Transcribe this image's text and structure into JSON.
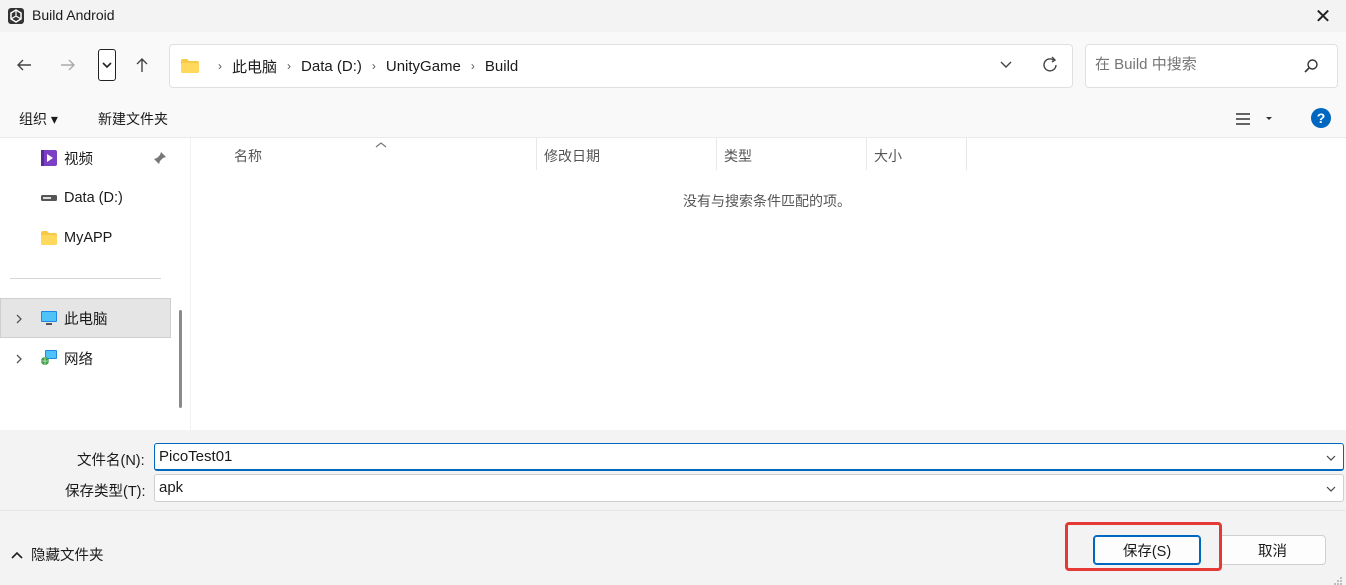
{
  "window": {
    "title": "Build Android",
    "close_glyph": "✕"
  },
  "nav": {
    "back_icon": "arrow-left-icon",
    "forward_icon": "arrow-right-icon",
    "up_icon": "arrow-up-icon",
    "breadcrumbs": [
      "此电脑",
      "Data (D:)",
      "UnityGame",
      "Build"
    ],
    "search_placeholder": "在 Build 中搜索"
  },
  "toolbar": {
    "organize": "组织 ▾",
    "new_folder": "新建文件夹"
  },
  "sidebar": {
    "videos": "视频",
    "data_drive": "Data (D:)",
    "myapp": "MyAPP",
    "this_pc": "此电脑",
    "network": "网络"
  },
  "columns": {
    "name": "名称",
    "modified": "修改日期",
    "type": "类型",
    "size": "大小"
  },
  "empty_message": "没有与搜索条件匹配的项。",
  "form": {
    "filename_label": "文件名(N):",
    "filename_value": "PicoTest01",
    "filetype_label": "保存类型(T):",
    "filetype_value": "apk"
  },
  "footer": {
    "hide_folders": "隐藏文件夹",
    "save": "保存(S)",
    "cancel": "取消"
  },
  "colors": {
    "accent": "#0067c0",
    "highlight": "#e53935"
  }
}
